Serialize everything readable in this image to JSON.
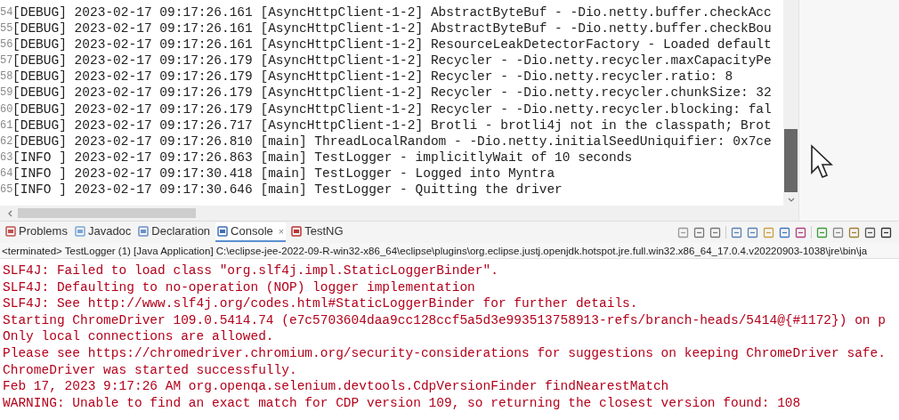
{
  "editor": {
    "lines": [
      {
        "number": "54",
        "text": "[DEBUG] 2023-02-17 09:17:26.161 [AsyncHttpClient-1-2] AbstractByteBuf - -Dio.netty.buffer.checkAcc"
      },
      {
        "number": "55",
        "text": "[DEBUG] 2023-02-17 09:17:26.161 [AsyncHttpClient-1-2] AbstractByteBuf - -Dio.netty.buffer.checkBou"
      },
      {
        "number": "56",
        "text": "[DEBUG] 2023-02-17 09:17:26.161 [AsyncHttpClient-1-2] ResourceLeakDetectorFactory - Loaded default"
      },
      {
        "number": "57",
        "text": "[DEBUG] 2023-02-17 09:17:26.179 [AsyncHttpClient-1-2] Recycler - -Dio.netty.recycler.maxCapacityPe"
      },
      {
        "number": "58",
        "text": "[DEBUG] 2023-02-17 09:17:26.179 [AsyncHttpClient-1-2] Recycler - -Dio.netty.recycler.ratio: 8"
      },
      {
        "number": "59",
        "text": "[DEBUG] 2023-02-17 09:17:26.179 [AsyncHttpClient-1-2] Recycler - -Dio.netty.recycler.chunkSize: 32"
      },
      {
        "number": "60",
        "text": "[DEBUG] 2023-02-17 09:17:26.179 [AsyncHttpClient-1-2] Recycler - -Dio.netty.recycler.blocking: fal"
      },
      {
        "number": "61",
        "text": "[DEBUG] 2023-02-17 09:17:26.717 [AsyncHttpClient-1-2] Brotli - brotli4j not in the classpath; Brot"
      },
      {
        "number": "62",
        "text": "[DEBUG] 2023-02-17 09:17:26.810 [main] ThreadLocalRandom - -Dio.netty.initialSeedUniquifier: 0x7ce"
      },
      {
        "number": "63",
        "text": "[INFO ] 2023-02-17 09:17:26.863 [main] TestLogger - implicitlyWait of 10 seconds"
      },
      {
        "number": "64",
        "text": "[INFO ] 2023-02-17 09:17:30.418 [main] TestLogger - Logged into Myntra"
      },
      {
        "number": "65",
        "text": "[INFO ] 2023-02-17 09:17:30.646 [main] TestLogger - Quitting the driver"
      }
    ]
  },
  "views": {
    "tabs": [
      {
        "label": "Problems",
        "selected": false
      },
      {
        "label": "Javadoc",
        "selected": false
      },
      {
        "label": "Declaration",
        "selected": false
      },
      {
        "label": "Console",
        "selected": true,
        "close": "×"
      },
      {
        "label": "TestNG",
        "selected": false
      }
    ]
  },
  "console": {
    "status": "<terminated> TestLogger (1) [Java Application] C:\\eclipse-jee-2022-09-R-win32-x86_64\\eclipse\\plugins\\org.eclipse.justj.openjdk.hotspot.jre.full.win32.x86_64_17.0.4.v20220903-1038\\jre\\bin\\ja",
    "lines": [
      "SLF4J: Failed to load class \"org.slf4j.impl.StaticLoggerBinder\".",
      "SLF4J: Defaulting to no-operation (NOP) logger implementation",
      "SLF4J: See http://www.slf4j.org/codes.html#StaticLoggerBinder for further details.",
      "Starting ChromeDriver 109.0.5414.74 (e7c5703604daa9cc128ccf5a5d3e993513758913-refs/branch-heads/5414@{#1172}) on p",
      "Only local connections are allowed.",
      "Please see https://chromedriver.chromium.org/security-considerations for suggestions on keeping ChromeDriver safe.",
      "ChromeDriver was started successfully.",
      "Feb 17, 2023 9:17:26 AM org.openqa.selenium.devtools.CdpVersionFinder findNearestMatch",
      "WARNING: Unable to find an exact match for CDP version 109, so returning the closest version found: 108"
    ]
  }
}
